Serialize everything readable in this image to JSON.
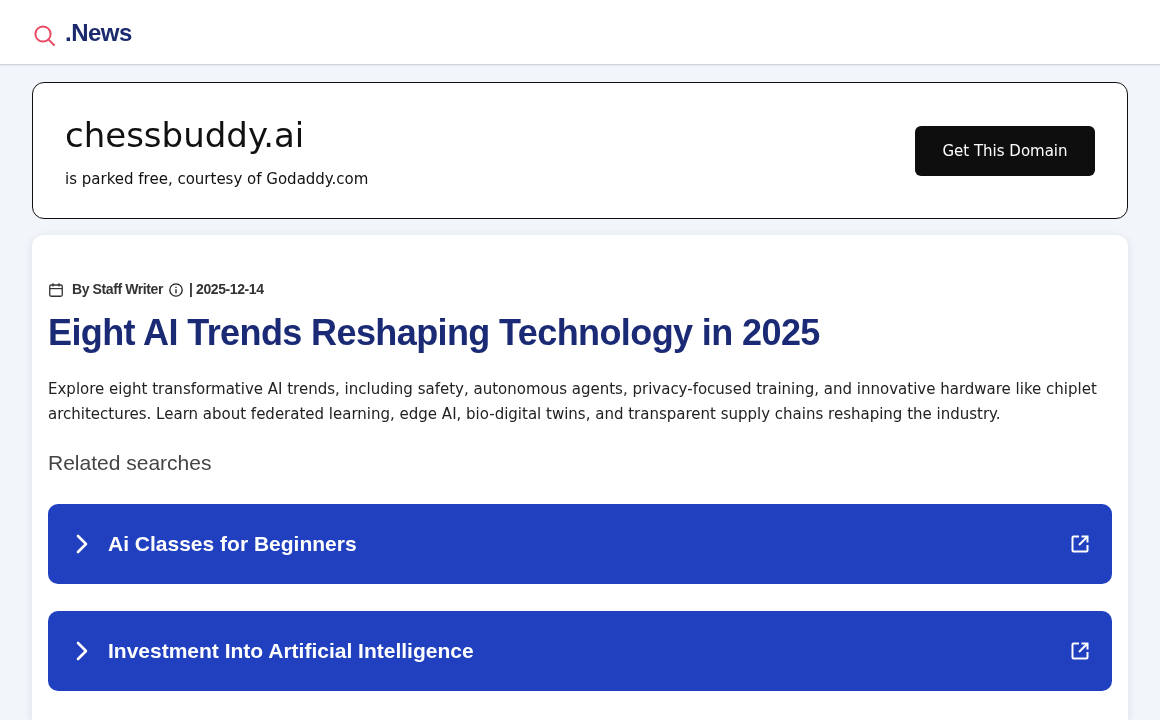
{
  "header": {
    "logo": ".News"
  },
  "domain_banner": {
    "domain": "chessbuddy.ai",
    "note": "is parked free, courtesy of Godaddy.com",
    "button": "Get This Domain"
  },
  "article": {
    "author": "By Staff Writer",
    "date": "| 2025-12-14",
    "title": "Eight AI Trends Reshaping Technology in 2025",
    "summary": "Explore eight transformative AI trends, including safety, autonomous agents, privacy-focused training, and innovative hardware like chiplet architectures. Learn about federated learning, edge AI, bio-digital twins, and transparent supply chains reshaping the industry.",
    "related_heading": "Related searches",
    "related_searches": [
      "Ai Classes for Beginners",
      "Investment Into Artificial Intelligence"
    ]
  }
}
